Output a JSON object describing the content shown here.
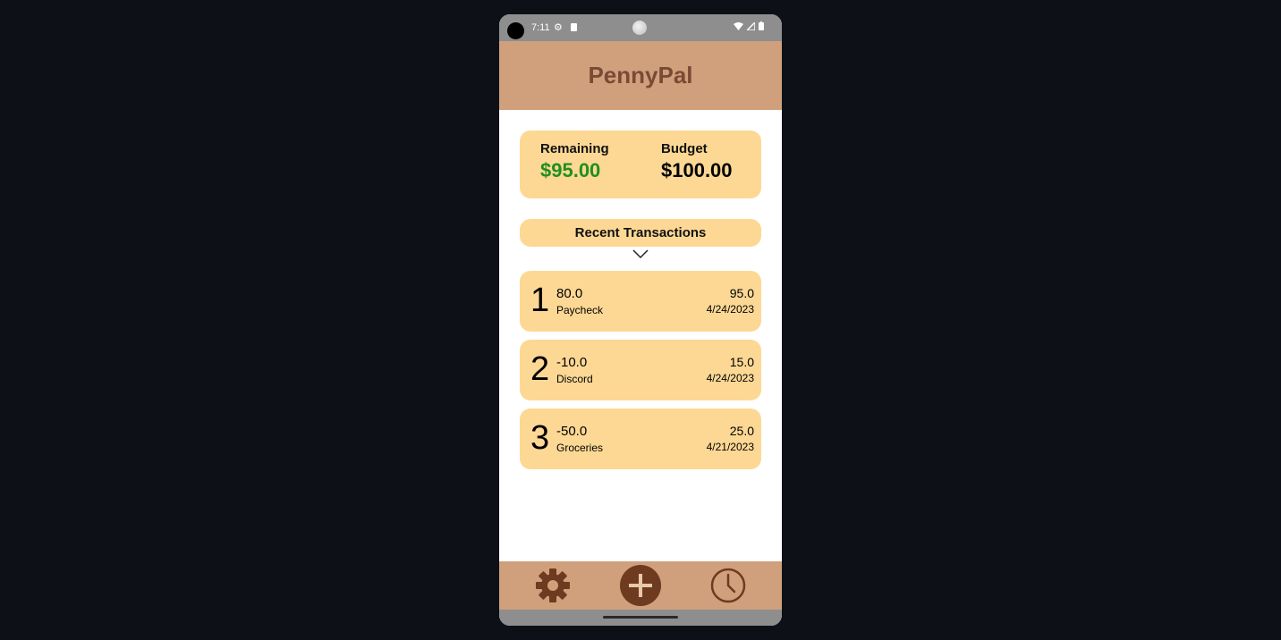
{
  "status_bar": {
    "time": "7:11",
    "icons": [
      "camera-cutout-icon",
      "settings-status-icon",
      "sd-card-icon",
      "notification-dot-icon",
      "wifi-icon",
      "cellular-icon",
      "battery-icon"
    ]
  },
  "app": {
    "title": "PennyPal",
    "colors": {
      "header": "#d0a07d",
      "card": "#fdd894",
      "title": "#7a4a35",
      "remaining": "#1f8f1f",
      "nav_icon": "#6e3a20"
    }
  },
  "summary": {
    "remaining_label": "Remaining",
    "remaining_value": "$95.00",
    "budget_label": "Budget",
    "budget_value": "$100.00"
  },
  "recent": {
    "label": "Recent Transactions",
    "expand_icon": "chevron-down-icon"
  },
  "transactions": [
    {
      "index": "1",
      "amount": "80.0",
      "name": "Paycheck",
      "balance": "95.0",
      "date": "4/24/2023"
    },
    {
      "index": "2",
      "amount": "-10.0",
      "name": "Discord",
      "balance": "15.0",
      "date": "4/24/2023"
    },
    {
      "index": "3",
      "amount": "-50.0",
      "name": "Groceries",
      "balance": "25.0",
      "date": "4/21/2023"
    }
  ],
  "nav": {
    "items": [
      "gear-icon",
      "add-icon",
      "clock-icon"
    ]
  }
}
